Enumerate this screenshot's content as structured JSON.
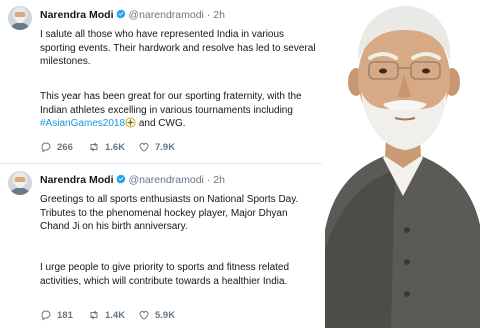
{
  "tweets": [
    {
      "name": "Narendra Modi",
      "handle": "@narendramodi",
      "separator": "·",
      "time": "2h",
      "paragraph1": "I salute all those who have represented India in various sporting events. Their hardwork and resolve has led to several milestones.",
      "paragraph2_prefix": "This year has been great for our sporting fraternity, with the Indian athletes excelling in various tournaments including ",
      "hashtag": "#AsianGames2018",
      "paragraph2_suffix": " and CWG.",
      "replies": "266",
      "retweets": "1.6K",
      "likes": "7.9K"
    },
    {
      "name": "Narendra Modi",
      "handle": "@narendramodi",
      "separator": "·",
      "time": "2h",
      "paragraph1": "Greetings to all sports enthusiasts on National Sports Day. Tributes to the phenomenal hockey player, Major Dhyan Chand Ji on his birth anniversary.",
      "paragraph2": "I urge people to give priority to sports and fitness related activities, which will contribute towards a healthier India.",
      "replies": "181",
      "retweets": "1.4K",
      "likes": "5.9K"
    }
  ],
  "colors": {
    "link": "#1b95e0",
    "verified": "#1da1f2",
    "muted": "#657786",
    "jacket": "#5c5a57"
  },
  "icons": [
    "verified-badge-icon",
    "reply-icon",
    "retweet-icon",
    "like-icon",
    "asian-games-emoji-icon"
  ]
}
